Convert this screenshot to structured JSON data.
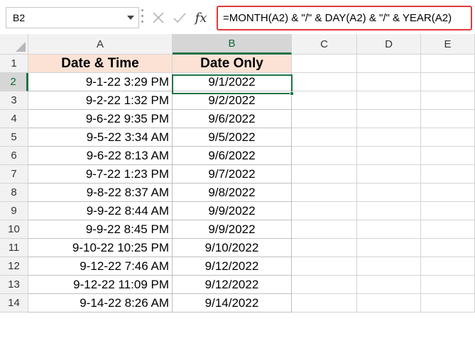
{
  "name_box": {
    "value": "B2"
  },
  "formula_bar": {
    "formula": "=MONTH(A2) & \"/\" & DAY(A2) & \"/\" & YEAR(A2)",
    "fx_label": "fx"
  },
  "columns": [
    "A",
    "B",
    "C",
    "D",
    "E"
  ],
  "selected_column": "B",
  "selected_row": 2,
  "row_numbers": [
    1,
    2,
    3,
    4,
    5,
    6,
    7,
    8,
    9,
    10,
    11,
    12,
    13,
    14
  ],
  "table": {
    "headers": {
      "a": "Date & Time",
      "b": "Date Only"
    },
    "rows": [
      {
        "a": "9-1-22 3:29 PM",
        "b": "9/1/2022"
      },
      {
        "a": "9-2-22 1:32 PM",
        "b": "9/2/2022"
      },
      {
        "a": "9-6-22 9:35 PM",
        "b": "9/6/2022"
      },
      {
        "a": "9-5-22 3:34 AM",
        "b": "9/5/2022"
      },
      {
        "a": "9-6-22 8:13 AM",
        "b": "9/6/2022"
      },
      {
        "a": "9-7-22 1:23 PM",
        "b": "9/7/2022"
      },
      {
        "a": "9-8-22 8:37 AM",
        "b": "9/8/2022"
      },
      {
        "a": "9-9-22 8:44 AM",
        "b": "9/9/2022"
      },
      {
        "a": "9-9-22 8:45 PM",
        "b": "9/9/2022"
      },
      {
        "a": "9-10-22 10:25 PM",
        "b": "9/10/2022"
      },
      {
        "a": "9-12-22 7:46 AM",
        "b": "9/12/2022"
      },
      {
        "a": "9-12-22 11:09 PM",
        "b": "9/12/2022"
      },
      {
        "a": "9-14-22 8:26 AM",
        "b": "9/14/2022"
      }
    ]
  },
  "colors": {
    "accent": "#217346",
    "header_fill": "#fbe2d5",
    "highlight_border": "#e03a3a"
  }
}
